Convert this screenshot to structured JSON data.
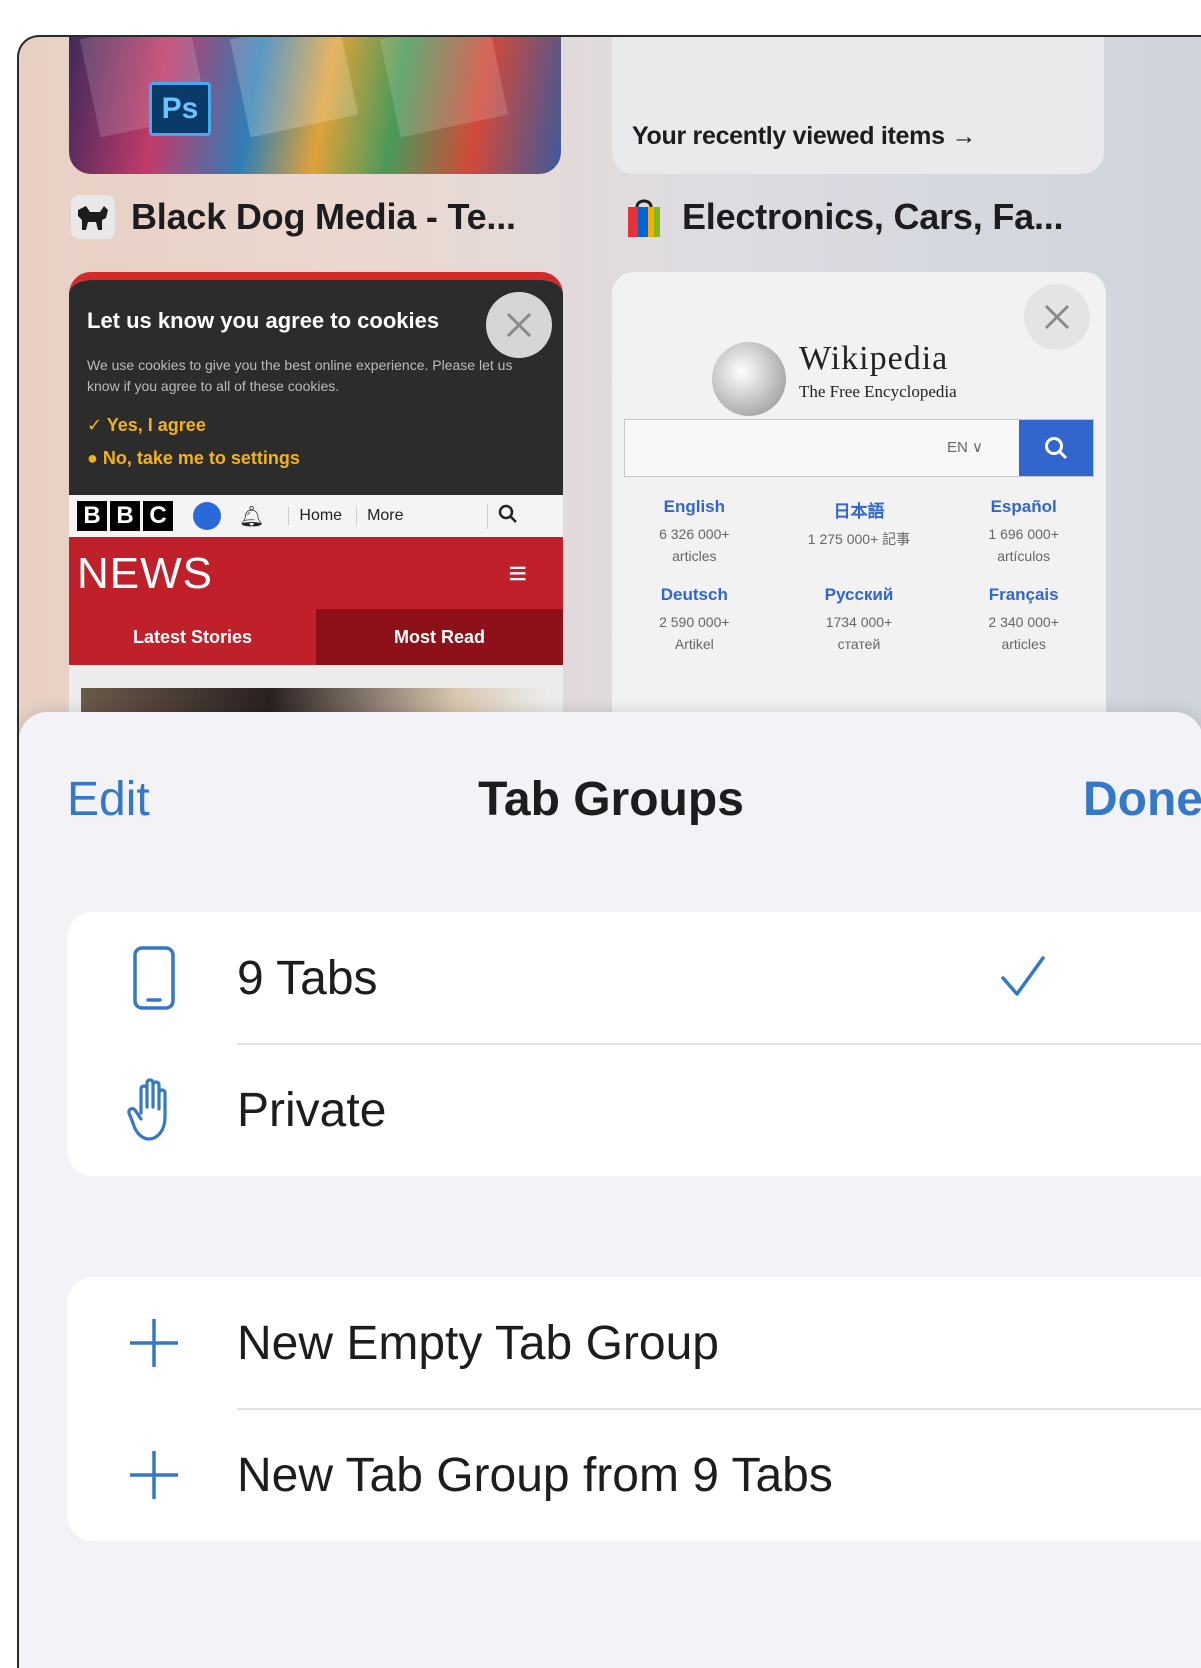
{
  "tabs_grid": {
    "thumb1": {
      "title": "Black Dog Media - Te...",
      "icon": "dog-favicon-icon",
      "image_text": "Ps"
    },
    "thumb2": {
      "title": "Electronics, Cars, Fa...",
      "icon": "shopping-bag-favicon-icon",
      "recent_link": "Your recently viewed items →"
    },
    "thumb3": {
      "cookie_heading": "Let us know you agree to cookies",
      "cookie_body": "We use cookies to give you the best online experience. Please let us know if you agree to all of these cookies.",
      "cookie_yes": "✓ Yes, I agree",
      "cookie_no": "● No, take me to settings",
      "bbc_letters": [
        "B",
        "B",
        "C"
      ],
      "bbc_nav_home": "Home",
      "bbc_nav_more": "More",
      "news_wordmark": "NEWS",
      "tab_latest": "Latest Stories",
      "tab_most_read": "Most Read"
    },
    "thumb4": {
      "wiki_title": "Wikipedia",
      "wiki_subtitle": "The Free Encyclopedia",
      "lang_selector": "EN ∨",
      "languages": [
        {
          "name": "English",
          "count": "6 326 000+ articles"
        },
        {
          "name": "日本語",
          "count": "1 275 000+ 記事"
        },
        {
          "name": "Español",
          "count": "1 696 000+ artículos"
        },
        {
          "name": "Deutsch",
          "count": "2 590 000+ Artikel"
        },
        {
          "name": "Русский",
          "count": "1734 000+ статей"
        },
        {
          "name": "Français",
          "count": "2 340 000+ articles"
        }
      ]
    }
  },
  "sheet": {
    "edit_label": "Edit",
    "title": "Tab Groups",
    "done_label": "Done",
    "groups": [
      {
        "label": "9 Tabs",
        "icon": "phone-icon",
        "selected": true
      },
      {
        "label": "Private",
        "icon": "hand-icon",
        "selected": false
      }
    ],
    "actions": [
      {
        "label": "New Empty Tab Group",
        "icon": "plus-icon"
      },
      {
        "label": "New Tab Group from 9 Tabs",
        "icon": "plus-icon"
      }
    ]
  },
  "colors": {
    "accent": "#3478c6",
    "bbc_red": "#c0202a",
    "wiki_blue": "#3366cc"
  }
}
